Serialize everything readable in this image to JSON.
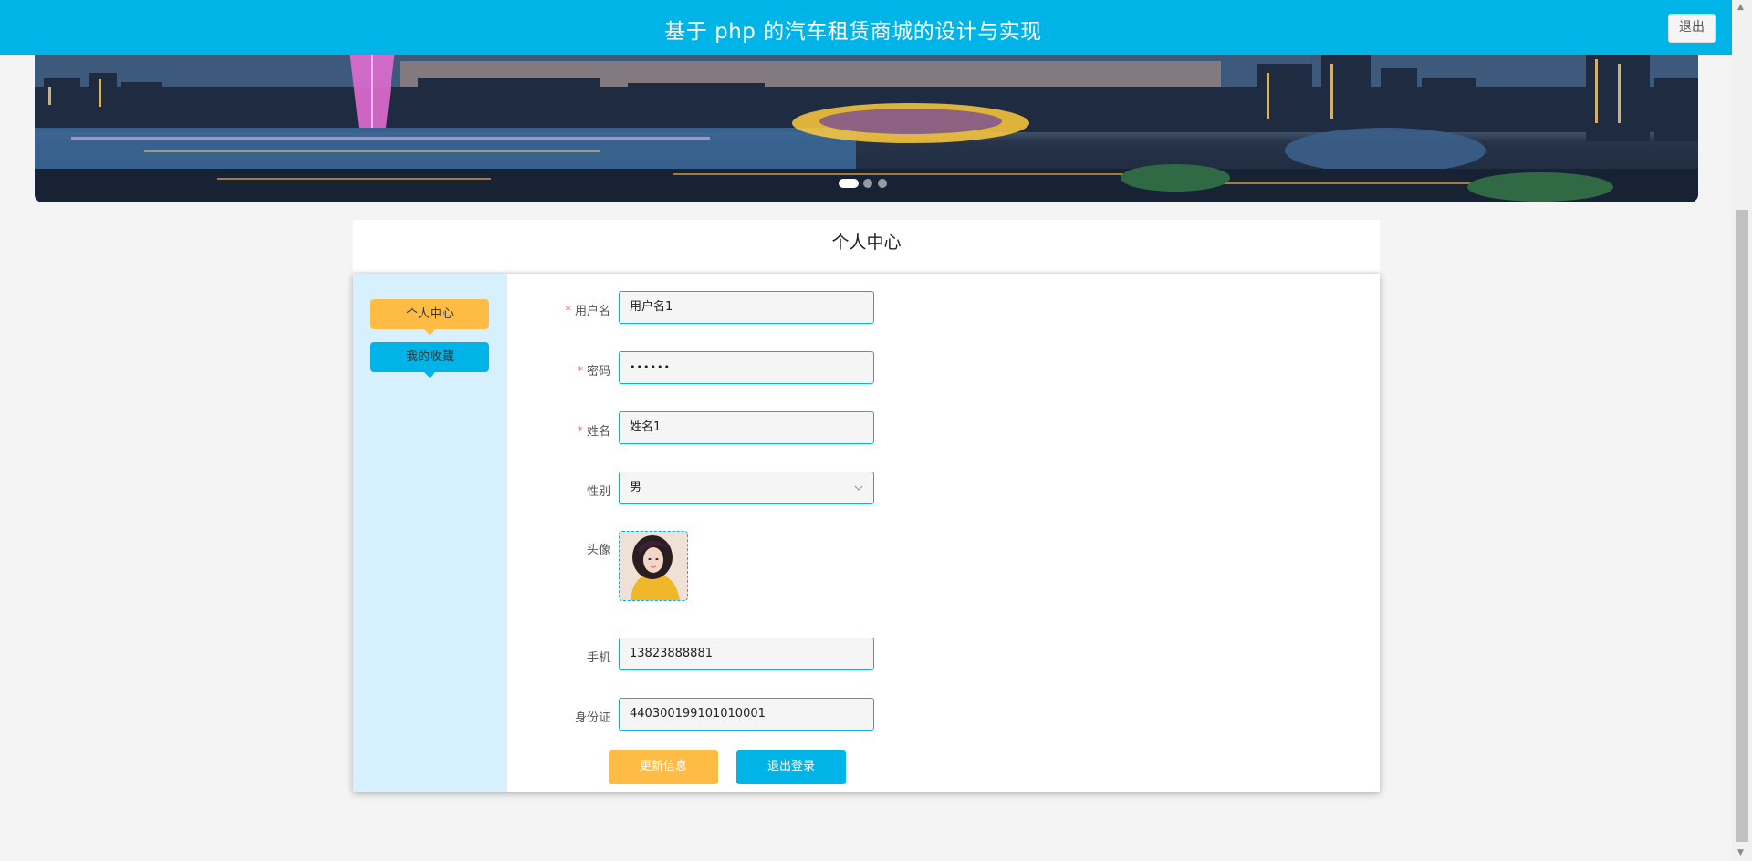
{
  "header": {
    "title": "基于 php 的汽车租赁商城的设计与实现",
    "logout_label": "退出",
    "bg_color": "#00b4e8"
  },
  "banner": {
    "slides": 3,
    "active_slide": 1
  },
  "page_title": "个人中心",
  "sidebar": {
    "items": [
      {
        "label": "个人中心",
        "color": "#ffbc45"
      },
      {
        "label": "我的收藏",
        "color": "#00b4e8"
      }
    ]
  },
  "form": {
    "username": {
      "label": "用户名",
      "required": true,
      "value": "用户名1"
    },
    "password": {
      "label": "密码",
      "required": true,
      "value": "••••••"
    },
    "name": {
      "label": "姓名",
      "required": true,
      "value": "姓名1"
    },
    "gender": {
      "label": "性别",
      "value": "男",
      "icon": "chevron-down-icon"
    },
    "avatar": {
      "label": "头像"
    },
    "phone": {
      "label": "手机",
      "value": "13823888881"
    },
    "id_card": {
      "label": "身份证",
      "value": "440300199101010001"
    },
    "required_mark": "*"
  },
  "actions": {
    "update_label": "更新信息",
    "logout_label": "退出登录"
  },
  "colors": {
    "accent": "#00b4e8",
    "orange": "#ffbc45",
    "sidebar_bg": "#d7f0fd",
    "required": "#f56c6c"
  }
}
